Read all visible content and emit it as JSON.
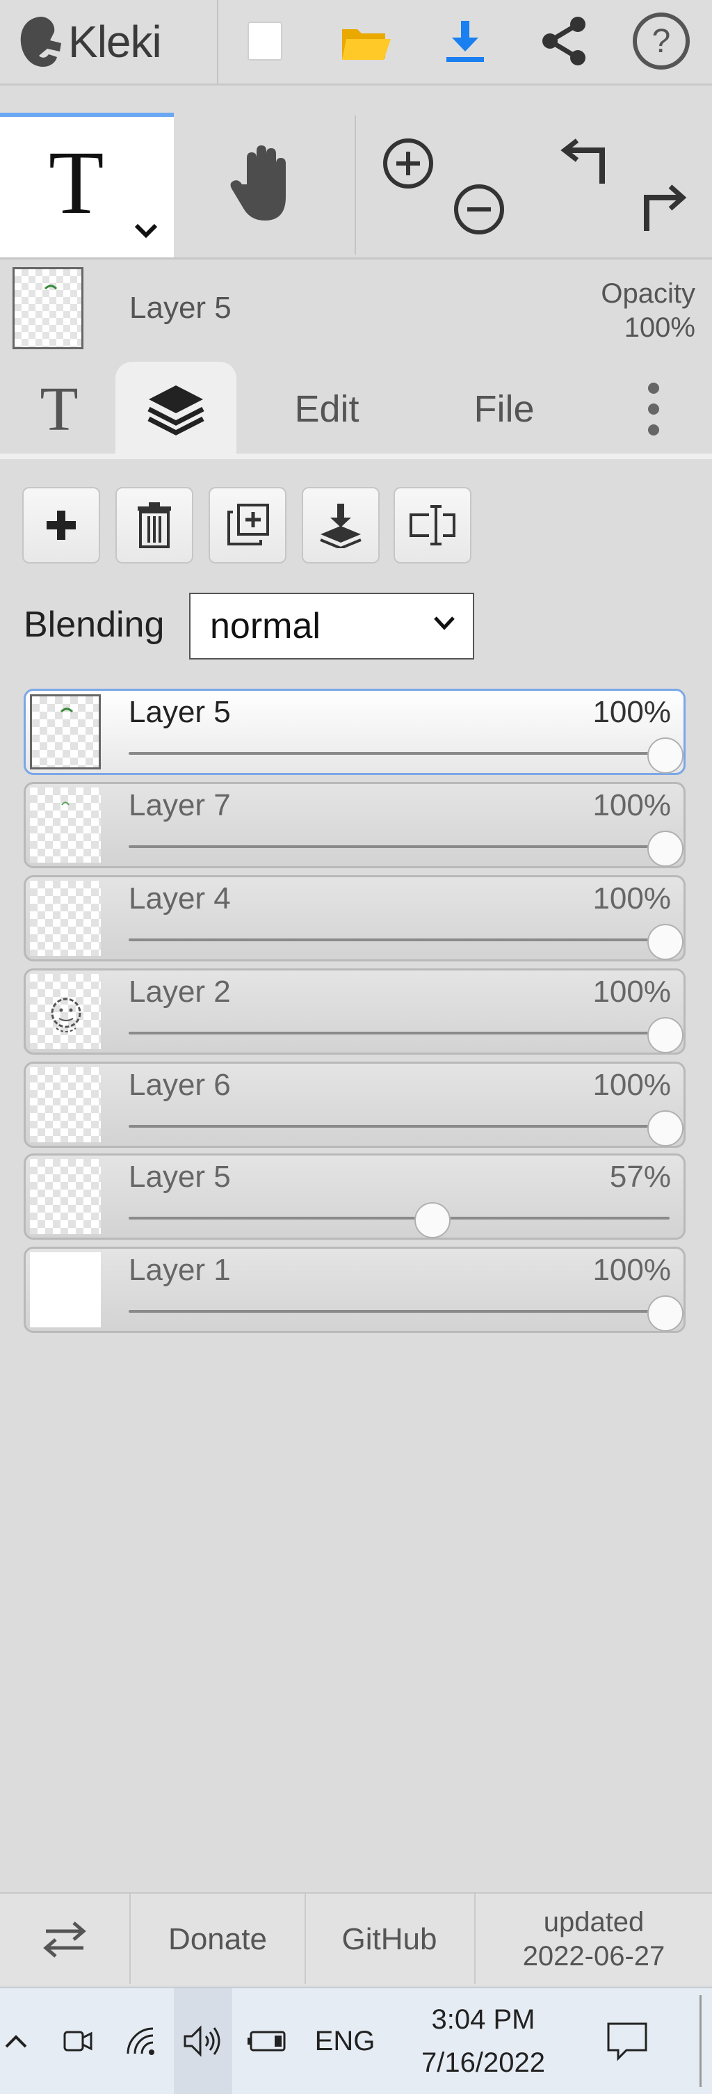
{
  "app": {
    "name": "Kleki",
    "top_icons": [
      "new-image-icon",
      "open-folder-icon",
      "download-icon",
      "share-icon",
      "help-icon"
    ],
    "accent": "#1a7ff0"
  },
  "tools": {
    "active_tool": "T",
    "items": [
      "text-tool-icon",
      "hand-icon",
      "zoom-in-icon",
      "zoom-out-icon",
      "undo-icon",
      "redo-icon"
    ]
  },
  "current_layer": {
    "name": "Layer 5",
    "opacity_label": "Opacity",
    "opacity_value": "100%"
  },
  "tabs": {
    "text_tab": "T",
    "edit": "Edit",
    "file": "File"
  },
  "layer_toolbar": [
    "add-layer-icon",
    "delete-layer-icon",
    "duplicate-layer-icon",
    "merge-down-icon",
    "rename-layer-icon"
  ],
  "blending": {
    "label": "Blending",
    "value": "normal"
  },
  "layers": [
    {
      "name": "Layer 5",
      "opacity": "100%",
      "level": 1.0,
      "active": true
    },
    {
      "name": "Layer 7",
      "opacity": "100%",
      "level": 1.0,
      "active": false
    },
    {
      "name": "Layer 4",
      "opacity": "100%",
      "level": 1.0,
      "active": false
    },
    {
      "name": "Layer 2",
      "opacity": "100%",
      "level": 1.0,
      "active": false
    },
    {
      "name": "Layer 6",
      "opacity": "100%",
      "level": 1.0,
      "active": false
    },
    {
      "name": "Layer 5",
      "opacity": "57%",
      "level": 0.57,
      "active": false
    },
    {
      "name": "Layer 1",
      "opacity": "100%",
      "level": 1.0,
      "active": false
    }
  ],
  "footer": {
    "donate": "Donate",
    "github": "GitHub",
    "updated_label": "updated",
    "updated_date": "2022-06-27"
  },
  "taskbar": {
    "language": "ENG",
    "time": "3:04 PM",
    "date": "7/16/2022"
  }
}
